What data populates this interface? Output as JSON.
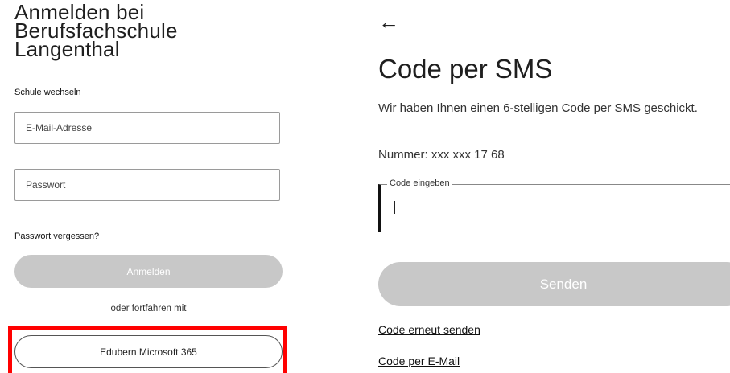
{
  "login": {
    "title": "Anmelden bei\nBerufsfachschule\nLangenthal",
    "switch_school": "Schule wechseln",
    "email_placeholder": "E-Mail-Adresse",
    "password_placeholder": "Passwort",
    "forgot_password": "Passwort vergessen?",
    "login_button": "Anmelden",
    "divider_text": "oder fortfahren mit",
    "ms_button": "Edubern Microsoft 365"
  },
  "sms": {
    "back_icon": "arrow-left-icon",
    "back_glyph": "←",
    "title": "Code per SMS",
    "description": "Wir haben Ihnen einen 6-stelligen Code per SMS geschickt.",
    "number": "Nummer: xxx xxx 17 68",
    "code_label": "Code eingeben",
    "send_button": "Senden",
    "resend_link": "Code erneut senden",
    "email_link": "Code per E-Mail"
  },
  "colors": {
    "highlight": "#ff0000",
    "disabled_button": "#c8c8c8"
  }
}
